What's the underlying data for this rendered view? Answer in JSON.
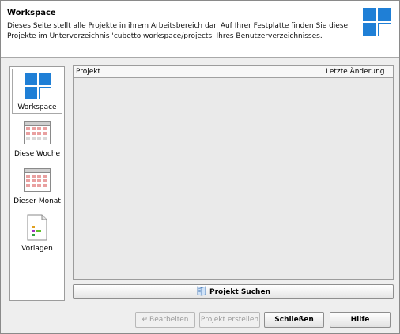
{
  "header": {
    "title": "Workspace",
    "description": "Dieses Seite stellt alle Projekte in ihrem Arbeitsbereich dar. Auf Ihrer Festplatte finden Sie diese Projekte im Unterverzeichnis 'cubetto.workspace/projects' Ihres Benutzerverzeichnisses.",
    "logo_icon": "workspace-icon"
  },
  "sidebar": {
    "items": [
      {
        "label": "Workspace",
        "icon": "workspace-icon",
        "selected": true
      },
      {
        "label": "Diese Woche",
        "icon": "week-calendar-icon",
        "selected": false
      },
      {
        "label": "Dieser Monat",
        "icon": "month-calendar-icon",
        "selected": false
      },
      {
        "label": "Vorlagen",
        "icon": "template-icon",
        "selected": false
      }
    ]
  },
  "table": {
    "columns": [
      "Projekt",
      "Letzte Änderung"
    ],
    "rows": []
  },
  "search_button": {
    "label": "Projekt Suchen",
    "icon": "search-book-icon"
  },
  "buttons": {
    "edit": {
      "label": "Bearbeiten",
      "enabled": false
    },
    "create": {
      "label": "Projekt erstellen",
      "enabled": false
    },
    "close": {
      "label": "Schließen",
      "enabled": true
    },
    "help": {
      "label": "Hilfe",
      "enabled": true
    }
  },
  "colors": {
    "accent_blue": "#1f7fd6",
    "border": "#9c9c9c",
    "background": "#eeeeee"
  }
}
